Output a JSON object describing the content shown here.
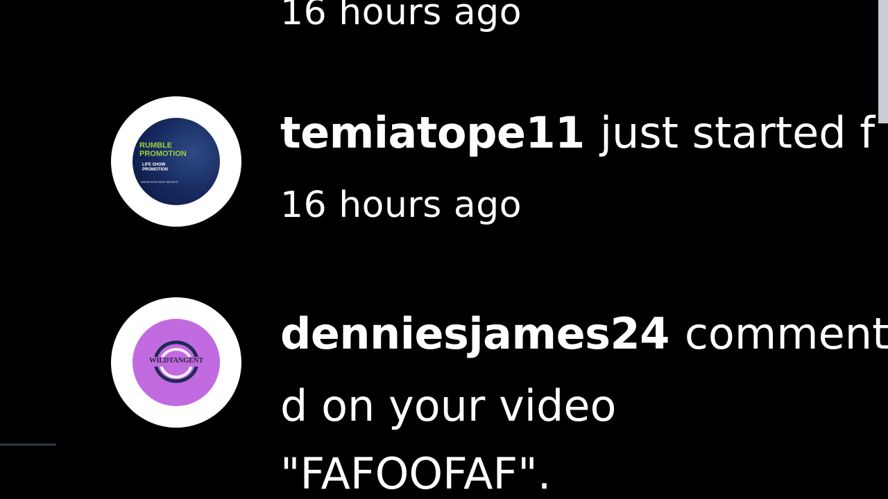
{
  "feed": {
    "top_time": "16 hours ago",
    "notifications": [
      {
        "username": "temiatope11",
        "action": "just started f",
        "time": "16 hours ago",
        "avatar": {
          "line1": "RUMBLE",
          "line2": "PROMOTION",
          "line3": "LIFE SHOW",
          "line4": "PROMOTION",
          "line5": "GROW WITH NEW HEIGHTS"
        }
      },
      {
        "username": "denniesjames24",
        "action": "comment",
        "line2": "d on your video",
        "line3": "\"FAFOOFAF\".",
        "avatar": {
          "logo_text": "WILDTANGENT"
        }
      }
    ]
  },
  "colors": {
    "background": "#000000",
    "text": "#ffffff",
    "rumble_green": "#9cd33a",
    "wild_purple": "#c26ae0"
  }
}
